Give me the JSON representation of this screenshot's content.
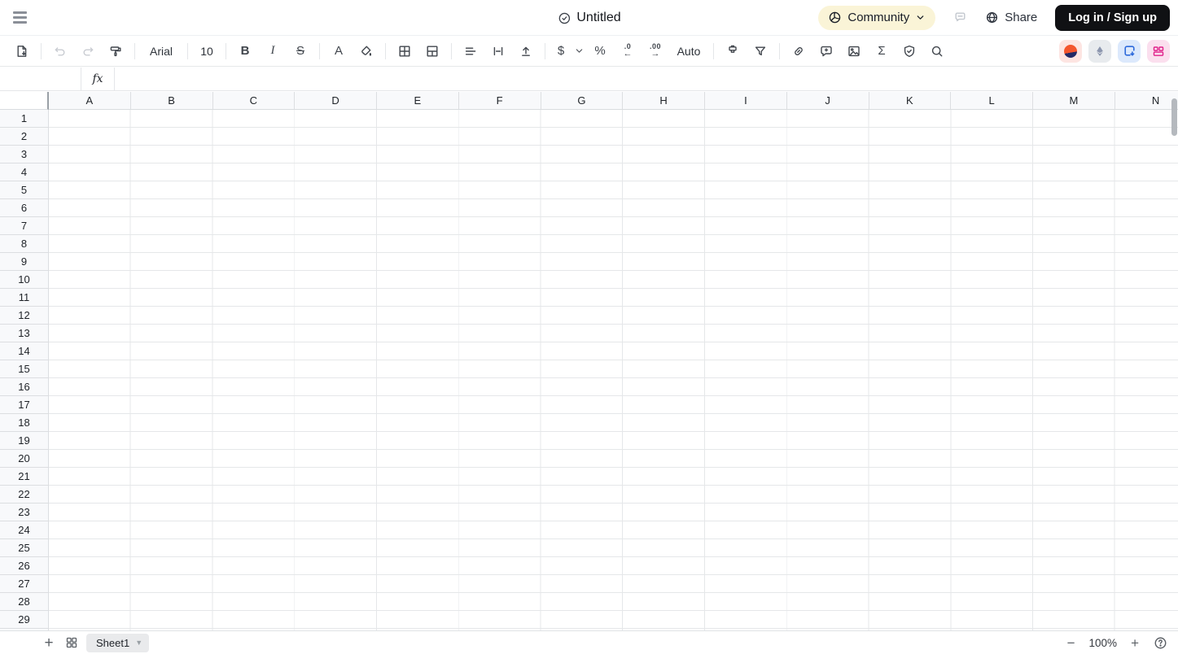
{
  "header": {
    "title": "Untitled",
    "community_label": "Community",
    "share_label": "Share",
    "login_label": "Log in / Sign up"
  },
  "toolbar": {
    "font_family_value": "Arial",
    "font_size_value": "10",
    "bold_label": "B",
    "italic_label": "I",
    "strikethrough_label": "S",
    "text_color_label": "A",
    "currency_label": "$",
    "percent_label": "%",
    "decrease_decimal_label": ".0",
    "decrease_decimal_arrow": "←",
    "increase_decimal_label": ".00",
    "increase_decimal_arrow": "→",
    "number_format_label": "Auto",
    "sum_label": "Σ"
  },
  "formula_bar": {
    "name_box_value": "",
    "fx_label": "fx",
    "formula_value": ""
  },
  "sheet": {
    "columns": [
      "A",
      "B",
      "C",
      "D",
      "E",
      "F",
      "G",
      "H",
      "I",
      "J",
      "K",
      "L",
      "M",
      "N"
    ],
    "rows": [
      "1",
      "2",
      "3",
      "4",
      "5",
      "6",
      "7",
      "8",
      "9",
      "10",
      "11",
      "12",
      "13",
      "14",
      "15",
      "16",
      "17",
      "18",
      "19",
      "20",
      "21",
      "22",
      "23",
      "24",
      "25",
      "26",
      "27",
      "28",
      "29"
    ]
  },
  "footer": {
    "add_sheet_label": "+",
    "sheet_tab_label": "Sheet1",
    "zoom_out_label": "−",
    "zoom_level": "100%",
    "zoom_in_label": "+"
  },
  "colors": {
    "community_pill_bg": "#FAF4D7",
    "login_button_bg": "#101114",
    "header_fill": "#F8F9FB",
    "gridline": "#E5E7E9",
    "plugin1_bg": "#FDE5E2",
    "plugin1_logo_top": "#F4562E",
    "plugin1_logo_bottom": "#232A66",
    "plugin2_bg": "#E8EBEE",
    "plugin2_icon": "#8C96AE",
    "plugin3_bg": "#DCE9FC",
    "plugin3_icon": "#2F6BDB",
    "plugin4_bg": "#FBDFEE",
    "plugin4_icon": "#E0218A"
  }
}
